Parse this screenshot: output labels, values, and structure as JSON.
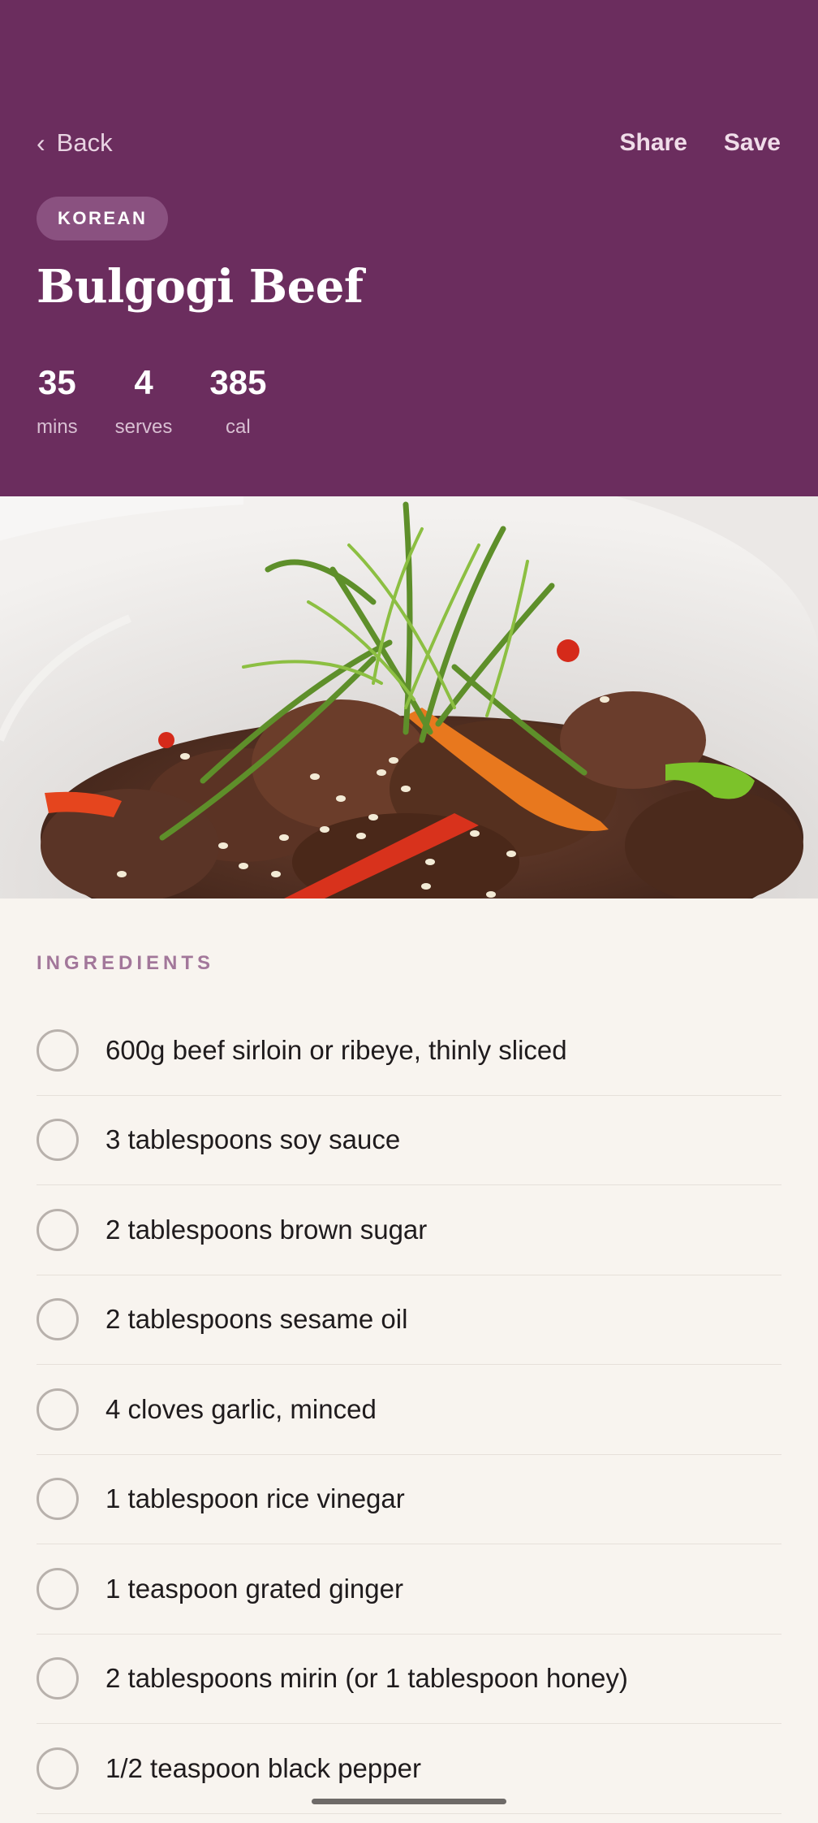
{
  "nav": {
    "back_label": "Back",
    "share_label": "Share",
    "save_label": "Save"
  },
  "recipe": {
    "cuisine": "KOREAN",
    "title": "Bulgogi Beef",
    "stats": [
      {
        "value": "35",
        "label": "mins"
      },
      {
        "value": "4",
        "label": "serves"
      },
      {
        "value": "385",
        "label": "cal"
      }
    ]
  },
  "ingredients": {
    "section_label": "INGREDIENTS",
    "items": [
      {
        "text": "600g beef sirloin or ribeye, thinly sliced",
        "checked": false
      },
      {
        "text": "3 tablespoons soy sauce",
        "checked": false
      },
      {
        "text": "2 tablespoons brown sugar",
        "checked": false
      },
      {
        "text": "2 tablespoons sesame oil",
        "checked": false
      },
      {
        "text": "4 cloves garlic, minced",
        "checked": false
      },
      {
        "text": "1 tablespoon rice vinegar",
        "checked": false
      },
      {
        "text": "1 teaspoon grated ginger",
        "checked": false
      },
      {
        "text": "2 tablespoons mirin (or 1 tablespoon honey)",
        "checked": false
      },
      {
        "text": "1/2 teaspoon black pepper",
        "checked": false
      }
    ]
  },
  "icons": {
    "back": "chevron-left-icon",
    "checkbox": "circle-checkbox-icon"
  },
  "colors": {
    "header_bg": "#6b2d5e",
    "badge_bg": "#8a5180",
    "page_bg": "#f8f4ef",
    "section_label": "#a2779a"
  }
}
